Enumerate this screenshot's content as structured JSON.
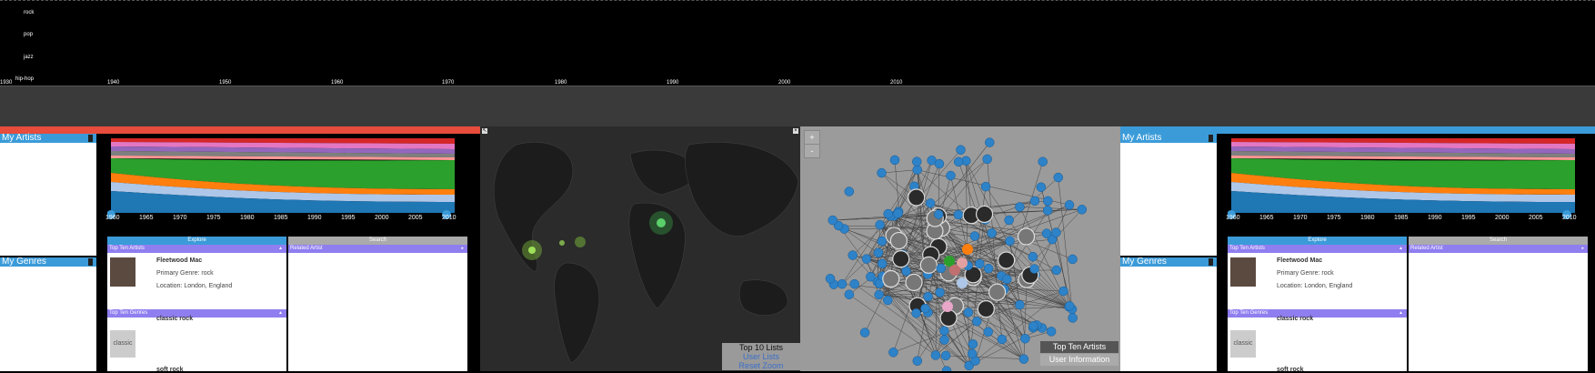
{
  "timeline": {
    "genres": [
      "rock",
      "pop",
      "jazz",
      "hip-hop"
    ],
    "years": [
      "1930",
      "1940",
      "1950",
      "1960",
      "1970",
      "1980",
      "1990",
      "2000",
      "2010"
    ]
  },
  "colors": {
    "accent_left": "#e74c3c",
    "accent_right": "#3b9bd9",
    "panel_header": "#3b9bd9",
    "purple": "#8f7ef0"
  },
  "left_panel": {
    "my_artists": "My Artists",
    "my_genres": "My Genres",
    "chart_years": [
      "1960",
      "1965",
      "1970",
      "1975",
      "1980",
      "1985",
      "1990",
      "1995",
      "2000",
      "2005",
      "2010"
    ],
    "tabs": {
      "explore": "Explore",
      "search": "Search"
    },
    "top_ten_artists": "Top Ten Artists",
    "related_artist": "Related Artist",
    "artist": {
      "name": "Fleetwood Mac",
      "genre": "Primary Genre: rock",
      "location": "Location: London, England"
    },
    "top_ten_genres": "Top Ten Genres",
    "genres": [
      {
        "name": "classic rock",
        "thumb": "classic"
      },
      {
        "name": "soft rock"
      }
    ]
  },
  "right_panel": {
    "my_artists": "My Artists",
    "my_genres": "My Genres",
    "chart_years": [
      "1960",
      "1965",
      "1970",
      "1975",
      "1980",
      "1985",
      "1990",
      "1995",
      "2000",
      "2005",
      "2010"
    ],
    "tabs": {
      "explore": "Explore",
      "search": "Search"
    },
    "top_ten_artists": "Top Ten Artists",
    "related_artist": "Related Artist",
    "artist": {
      "name": "Fleetwood Mac",
      "genre": "Primary Genre: rock",
      "location": "Location: London, England"
    },
    "top_ten_genres": "Top Ten Genres",
    "genres": [
      {
        "name": "classic rock",
        "thumb": "classic"
      },
      {
        "name": "soft rock"
      }
    ]
  },
  "map": {
    "zoom_in": "+",
    "zoom_out": "-",
    "top_lists": "Top 10 Lists",
    "user_lists": "User Lists",
    "reset_zoom": "Reset Zoom"
  },
  "network": {
    "zoom_in": "+",
    "zoom_out": "-",
    "top_ten_artists": "Top Ten Artists",
    "user_information": "User Information"
  }
}
